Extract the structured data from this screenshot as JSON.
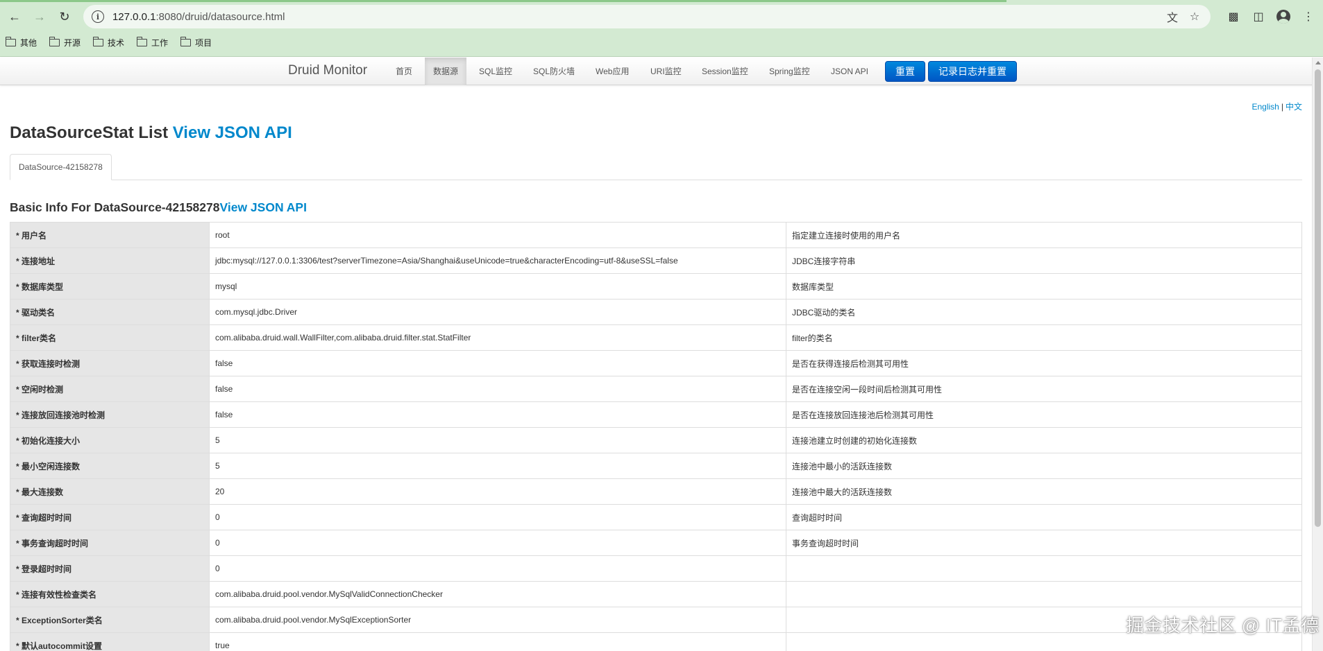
{
  "browser": {
    "url_host": "127.0.0.1",
    "url_rest": ":8080/druid/datasource.html",
    "bookmarks": [
      "其他",
      "开源",
      "技术",
      "工作",
      "项目"
    ]
  },
  "nav": {
    "brand": "Druid Monitor",
    "items": [
      "首页",
      "数据源",
      "SQL监控",
      "SQL防火墙",
      "Web应用",
      "URI监控",
      "Session监控",
      "Spring监控",
      "JSON API"
    ],
    "active": "数据源",
    "reset_label": "重置",
    "log_reset_label": "记录日志并重置"
  },
  "lang": {
    "english": "English",
    "separator": "|",
    "chinese": "中文"
  },
  "page": {
    "title": "DataSourceStat List",
    "title_link": "View JSON API",
    "tab": "DataSource-42158278",
    "section_title": "Basic Info For DataSource-42158278",
    "section_link": "View JSON API"
  },
  "rows": [
    {
      "key": "* 用户名",
      "value": "root",
      "desc": "指定建立连接时使用的用户名"
    },
    {
      "key": "* 连接地址",
      "value": "jdbc:mysql://127.0.0.1:3306/test?serverTimezone=Asia/Shanghai&useUnicode=true&characterEncoding=utf-8&useSSL=false",
      "desc": "JDBC连接字符串"
    },
    {
      "key": "* 数据库类型",
      "value": "mysql",
      "desc": "数据库类型"
    },
    {
      "key": "* 驱动类名",
      "value": "com.mysql.jdbc.Driver",
      "desc": "JDBC驱动的类名"
    },
    {
      "key": "* filter类名",
      "value": "com.alibaba.druid.wall.WallFilter,com.alibaba.druid.filter.stat.StatFilter",
      "desc": "filter的类名"
    },
    {
      "key": "* 获取连接时检测",
      "value": "false",
      "desc": "是否在获得连接后检测其可用性"
    },
    {
      "key": "* 空闲时检测",
      "value": "false",
      "desc": "是否在连接空闲一段时间后检测其可用性"
    },
    {
      "key": "* 连接放回连接池时检测",
      "value": "false",
      "desc": "是否在连接放回连接池后检测其可用性"
    },
    {
      "key": "* 初始化连接大小",
      "value": "5",
      "desc": "连接池建立时创建的初始化连接数"
    },
    {
      "key": "* 最小空闲连接数",
      "value": "5",
      "desc": "连接池中最小的活跃连接数"
    },
    {
      "key": "* 最大连接数",
      "value": "20",
      "desc": "连接池中最大的活跃连接数"
    },
    {
      "key": "* 查询超时时间",
      "value": "0",
      "desc": "查询超时时间"
    },
    {
      "key": "* 事务查询超时时间",
      "value": "0",
      "desc": "事务查询超时时间"
    },
    {
      "key": "* 登录超时时间",
      "value": "0",
      "desc": ""
    },
    {
      "key": "* 连接有效性检查类名",
      "value": "com.alibaba.druid.pool.vendor.MySqlValidConnectionChecker",
      "desc": ""
    },
    {
      "key": "* ExceptionSorter类名",
      "value": "com.alibaba.druid.pool.vendor.MySqlExceptionSorter",
      "desc": ""
    },
    {
      "key": "* 默认autocommit设置",
      "value": "true",
      "desc": ""
    }
  ],
  "watermark": "掘金技术社区 @ IT孟德",
  "colors": {
    "accent": "#0088cc",
    "button": "#0066cc",
    "chrome": "#d3ead2"
  }
}
